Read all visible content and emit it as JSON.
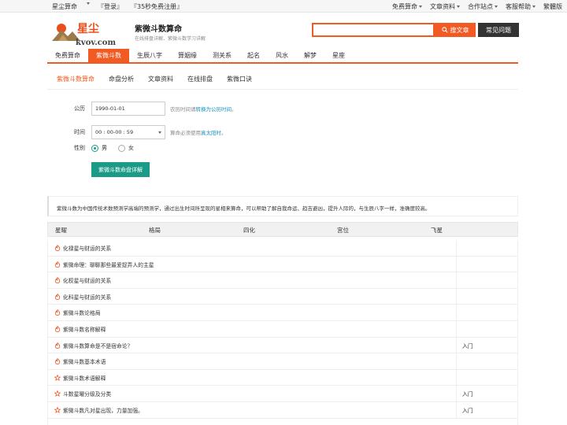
{
  "topbar": {
    "left": [
      "星尘算命",
      "『登录』",
      "『35秒免费注册』"
    ],
    "right": [
      "免费算命",
      "文章资料",
      "合作站点",
      "客服帮助",
      "繁體版"
    ]
  },
  "header": {
    "logo_text": "星尘",
    "logo_domain": "kvov.com",
    "title": "紫微斗数算命",
    "subtitle": "在线排盘详解、紫微斗数学习详解",
    "search_button": "搜文章",
    "faq_button": "常见问题"
  },
  "mainnav": [
    "免费算命",
    "紫微斗数",
    "生辰八字",
    "算姻缘",
    "测关系",
    "起名",
    "风水",
    "解梦",
    "星座"
  ],
  "subnav": [
    "紫微斗数算命",
    "命盘分析",
    "文章资料",
    "在线排盘",
    "紫微口诀"
  ],
  "form": {
    "date_label": "公历",
    "date_value": "1990-01-01",
    "date_hint_pre": "农历时间请",
    "date_hint_link": "转换为公历时间",
    "date_hint_post": "。",
    "time_label": "时间",
    "time_value": "00 : 00-00 : 59",
    "time_hint_pre": "算命必须使用",
    "time_hint_link": "真太阳时",
    "time_hint_post": "。",
    "gender_label": "性别",
    "gender_male": "男",
    "gender_female": "女",
    "submit": "紫微斗数命盘详解"
  },
  "intro": "紫微斗数为中国传统术数预测学高端的预测学，通过出生时间所呈现的星相来算命，可以帮助了解自我命运、趋吉避凶，提升人际的，与生辰八字一样，准确度较高。",
  "table": {
    "headers": [
      "星曜",
      "格局",
      "四化",
      "宫位",
      "飞星"
    ]
  },
  "articles": [
    {
      "title": "化禄星与财运的关系",
      "tag": "",
      "icon": "flame-icon"
    },
    {
      "title": "紫微命理：聊聊那些最爱捉弄人的主星",
      "tag": "",
      "icon": "flame-icon"
    },
    {
      "title": "化权星与财运的关系",
      "tag": "",
      "icon": "flame-icon"
    },
    {
      "title": "化科星与财运的关系",
      "tag": "",
      "icon": "flame-icon"
    },
    {
      "title": "紫微斗数论格局",
      "tag": "",
      "icon": "flame-icon"
    },
    {
      "title": "紫微斗数名称解释",
      "tag": "",
      "icon": "flame-icon"
    },
    {
      "title": "紫微斗数算命是不是宿命论？",
      "tag": "入门",
      "icon": "flame-icon"
    },
    {
      "title": "紫微斗数基本术语",
      "tag": "",
      "icon": "flame-icon"
    },
    {
      "title": "紫微斗数术语解释",
      "tag": "",
      "icon": "star-icon"
    },
    {
      "title": "斗数星曜分级及分类",
      "tag": "入门",
      "icon": "star-icon"
    },
    {
      "title": "紫微斗数凡对星出现，力量加强。",
      "tag": "入门",
      "icon": "star-icon"
    }
  ],
  "colors": {
    "accent": "#f15a22",
    "teal": "#1a9b87",
    "link": "#1a8fbf"
  }
}
